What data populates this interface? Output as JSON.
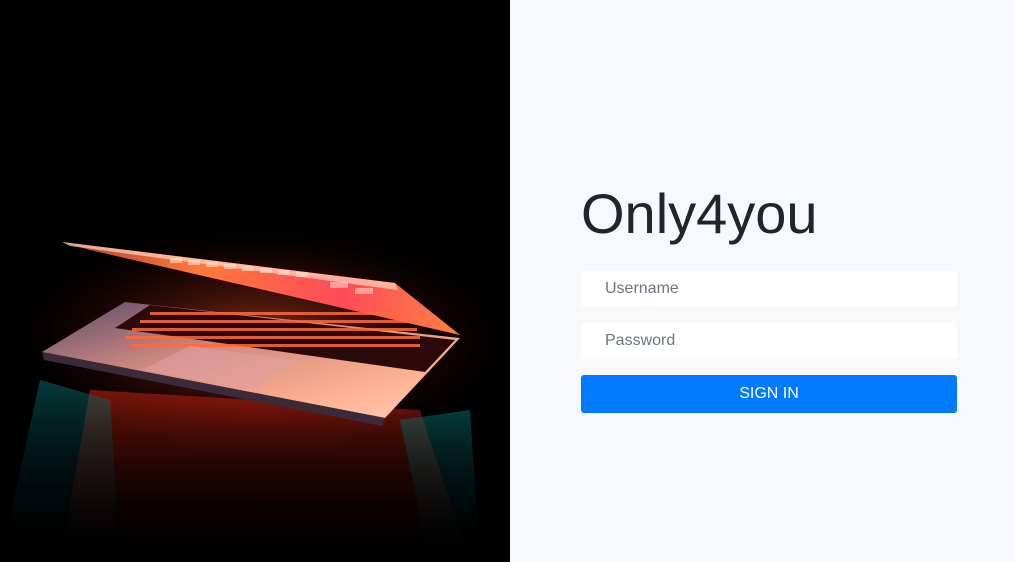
{
  "login": {
    "brand_title": "Only4you",
    "username": {
      "placeholder": "Username",
      "value": ""
    },
    "password": {
      "placeholder": "Password",
      "value": ""
    },
    "submit_label": "SIGN IN"
  },
  "hero": {
    "image_subject": "laptop-photo",
    "background_color": "#000000"
  },
  "colors": {
    "panel_background": "#f7f8fa",
    "accent": "#007bff",
    "title_text": "#212529"
  }
}
